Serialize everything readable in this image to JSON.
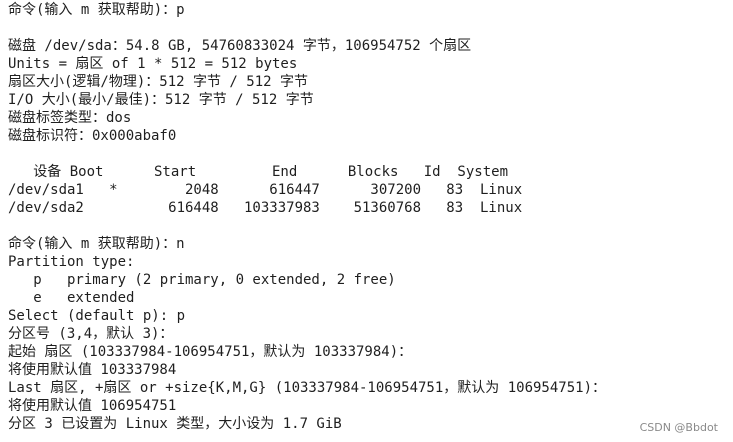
{
  "terminal": {
    "lines": [
      "命令(输入 m 获取帮助)：p",
      "",
      "磁盘 /dev/sda：54.8 GB, 54760833024 字节，106954752 个扇区",
      "Units = 扇区 of 1 * 512 = 512 bytes",
      "扇区大小(逻辑/物理)：512 字节 / 512 字节",
      "I/O 大小(最小/最佳)：512 字节 / 512 字节",
      "磁盘标签类型：dos",
      "磁盘标识符：0x000abaf0",
      "",
      "   设备 Boot      Start         End      Blocks   Id  System",
      "/dev/sda1   *        2048      616447      307200   83  Linux",
      "/dev/sda2          616448   103337983    51360768   83  Linux",
      "",
      "命令(输入 m 获取帮助)：n",
      "Partition type:",
      "   p   primary (2 primary, 0 extended, 2 free)",
      "   e   extended",
      "Select (default p): p",
      "分区号 (3,4，默认 3)：",
      "起始 扇区 (103337984-106954751，默认为 103337984)：",
      "将使用默认值 103337984",
      "Last 扇区, +扇区 or +size{K,M,G} (103337984-106954751，默认为 106954751)：",
      "将使用默认值 106954751",
      "分区 3 已设置为 Linux 类型，大小设为 1.7 GiB"
    ]
  },
  "watermark": "CSDN @Bbdot"
}
